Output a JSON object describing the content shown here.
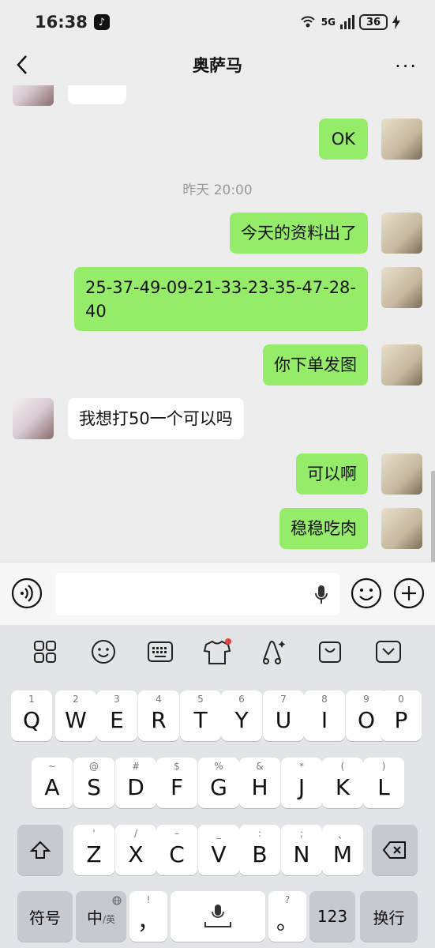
{
  "status_bar": {
    "time": "16:38",
    "app_badge": "♪",
    "network": "5G",
    "battery": "36"
  },
  "header": {
    "title": "奥萨马",
    "back_icon": "chevron-left-icon",
    "more_icon": "more-dots-icon",
    "more_glyph": "···"
  },
  "chat": {
    "timestamp": "昨天 20:00",
    "messages": [
      {
        "from": "me",
        "text": "OK"
      },
      {
        "from": "me",
        "text": "今天的资料出了"
      },
      {
        "from": "me",
        "text": "25-37-49-09-21-33-23-35-47-28-40"
      },
      {
        "from": "me",
        "text": "你下单发图"
      },
      {
        "from": "other",
        "text": "我想打50一个可以吗"
      },
      {
        "from": "me",
        "text": "可以啊"
      },
      {
        "from": "me",
        "text": "稳稳吃肉"
      }
    ]
  },
  "keyboard": {
    "row1": [
      {
        "hint": "1",
        "key": "Q"
      },
      {
        "hint": "2",
        "key": "W"
      },
      {
        "hint": "3",
        "key": "E"
      },
      {
        "hint": "4",
        "key": "R"
      },
      {
        "hint": "5",
        "key": "T"
      },
      {
        "hint": "6",
        "key": "Y"
      },
      {
        "hint": "7",
        "key": "U"
      },
      {
        "hint": "8",
        "key": "I"
      },
      {
        "hint": "9",
        "key": "O"
      },
      {
        "hint": "0",
        "key": "P"
      }
    ],
    "row2": [
      {
        "hint": "~",
        "key": "A"
      },
      {
        "hint": "@",
        "key": "S"
      },
      {
        "hint": "#",
        "key": "D"
      },
      {
        "hint": "$",
        "key": "F"
      },
      {
        "hint": "%",
        "key": "G"
      },
      {
        "hint": "&",
        "key": "H"
      },
      {
        "hint": "*",
        "key": "J"
      },
      {
        "hint": "(",
        "key": "K"
      },
      {
        "hint": ")",
        "key": "L"
      }
    ],
    "row3": [
      {
        "hint": "'",
        "key": "Z"
      },
      {
        "hint": "/",
        "key": "X"
      },
      {
        "hint": "–",
        "key": "C"
      },
      {
        "hint": "_",
        "key": "V"
      },
      {
        "hint": ":",
        "key": "B"
      },
      {
        "hint": ";",
        "key": "N"
      },
      {
        "hint": "、",
        "key": "M"
      }
    ],
    "symbols_label": "符号",
    "lang_main": "中",
    "lang_sub": "/英",
    "comma_hint": "!",
    "comma": "，",
    "question_hint": "?",
    "period": "。",
    "num_label": "123",
    "enter_label": "换行"
  }
}
